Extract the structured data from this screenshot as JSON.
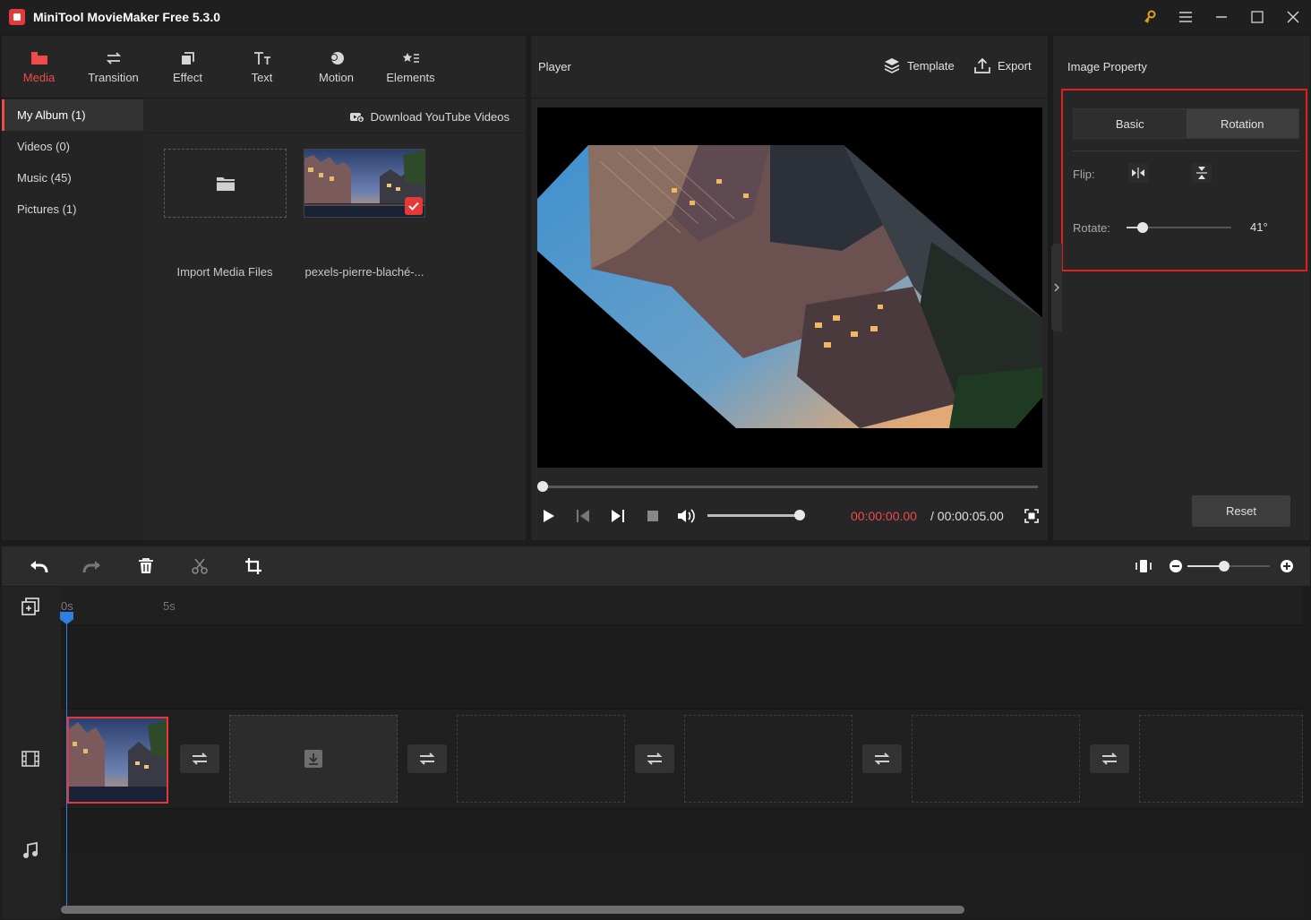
{
  "app": {
    "title": "MiniTool MovieMaker Free 5.3.0",
    "accent_color": "#ef4b4b",
    "window_icons": [
      "key-icon",
      "menu-icon",
      "minimize-icon",
      "maximize-icon",
      "close-icon"
    ]
  },
  "nav": {
    "items": [
      {
        "label": "Media",
        "icon": "folder-icon",
        "active": true
      },
      {
        "label": "Transition",
        "icon": "transition-icon"
      },
      {
        "label": "Effect",
        "icon": "effect-icon"
      },
      {
        "label": "Text",
        "icon": "text-icon"
      },
      {
        "label": "Motion",
        "icon": "motion-icon"
      },
      {
        "label": "Elements",
        "icon": "elements-icon"
      }
    ]
  },
  "album": {
    "items": [
      {
        "label": "My Album (1)",
        "active": true
      },
      {
        "label": "Videos (0)"
      },
      {
        "label": "Music (45)"
      },
      {
        "label": "Pictures (1)"
      }
    ],
    "download_label": "Download YouTube Videos",
    "import_label": "Import Media Files",
    "media_file_label": "pexels-pierre-blaché-..."
  },
  "player": {
    "title": "Player",
    "template_label": "Template",
    "export_label": "Export",
    "time_current": "00:00:00.00",
    "time_total": "/ 00:00:05.00",
    "progress": 0.0,
    "volume": 1.0
  },
  "property": {
    "title": "Image Property",
    "tabs": [
      {
        "label": "Basic",
        "active": false
      },
      {
        "label": "Rotation",
        "active": true
      }
    ],
    "flip_label": "Flip:",
    "rotate_label": "Rotate:",
    "rotate_value": "41°",
    "rotate_degrees": 41,
    "reset_label": "Reset",
    "highlight_color": "#e21f1f"
  },
  "timeline": {
    "ruler": [
      "0s",
      "5s"
    ],
    "playhead_color": "#2f7fe0",
    "zoom_level": 0.45,
    "toolbar_icons": [
      "undo-icon",
      "redo-icon",
      "delete-icon",
      "split-icon",
      "crop-icon"
    ]
  }
}
